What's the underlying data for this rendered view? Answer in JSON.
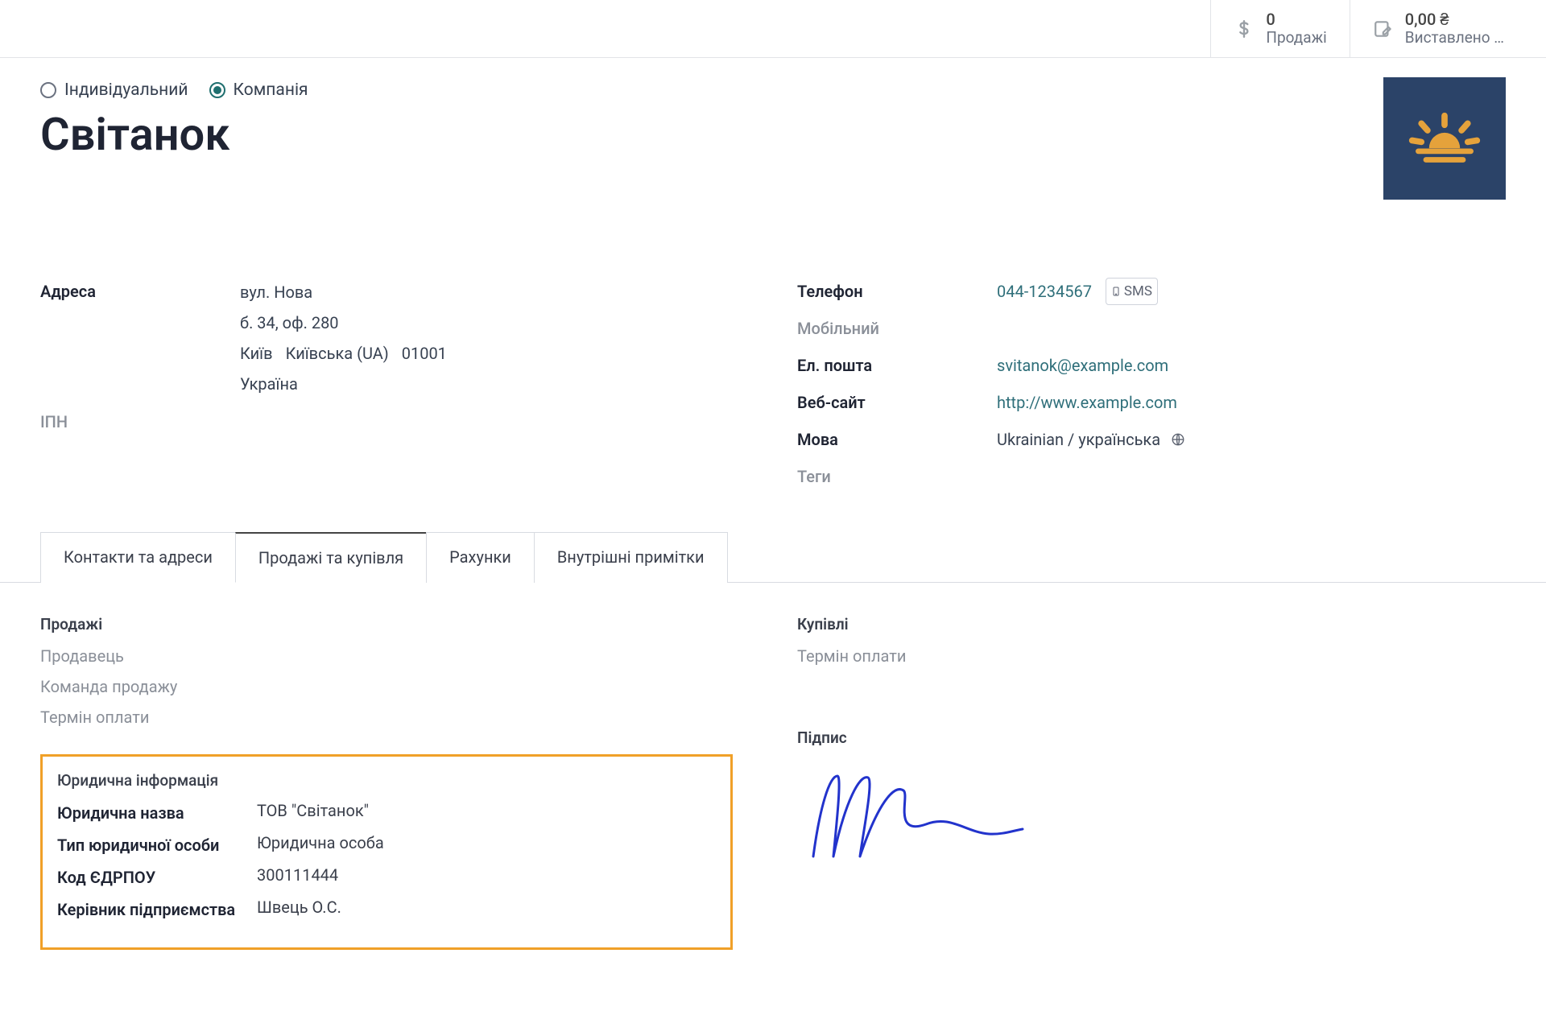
{
  "header": {
    "sales_count": "0",
    "sales_label": "Продажі",
    "invoiced_amount": "0,00 ₴",
    "invoiced_label": "Виставлено …"
  },
  "type": {
    "individual": "Індивідуальний",
    "company": "Компанія"
  },
  "title": "Світанок",
  "left": {
    "address_label": "Адреса",
    "street": "вул. Нова",
    "building": "б. 34, оф. 280",
    "city": "Київ",
    "region": "Київська (UA)",
    "zip": "01001",
    "country": "Україна",
    "ipn_label": "ІПН"
  },
  "right": {
    "phone_label": "Телефон",
    "phone_value": "044-1234567",
    "sms": "SMS",
    "mobile_label": "Мобільний",
    "email_label": "Ел. пошта",
    "email_value": "svitanok@example.com",
    "website_label": "Веб-сайт",
    "website_value": "http://www.example.com",
    "language_label": "Мова",
    "language_value": "Ukrainian / українська",
    "tags_label": "Теги"
  },
  "tabs": {
    "t1": "Контакти та адреси",
    "t2": "Продажі та купівля",
    "t3": "Рахунки",
    "t4": "Внутрішні примітки"
  },
  "sales": {
    "title": "Продажі",
    "seller": "Продавець",
    "team": "Команда продажу",
    "payterm": "Термін оплати"
  },
  "purchases": {
    "title": "Купівлі",
    "payterm": "Термін оплати"
  },
  "legal": {
    "title": "Юридична інформація",
    "name_label": "Юридична назва",
    "name_value": "ТОВ \"Світанок\"",
    "type_label": "Тип юридичної особи",
    "type_value": "Юридична особа",
    "code_label": "Код ЄДРПОУ",
    "code_value": "300111444",
    "head_label": "Керівник підприємства",
    "head_value": "Швець О.С."
  },
  "signature": {
    "title": "Підпис"
  }
}
